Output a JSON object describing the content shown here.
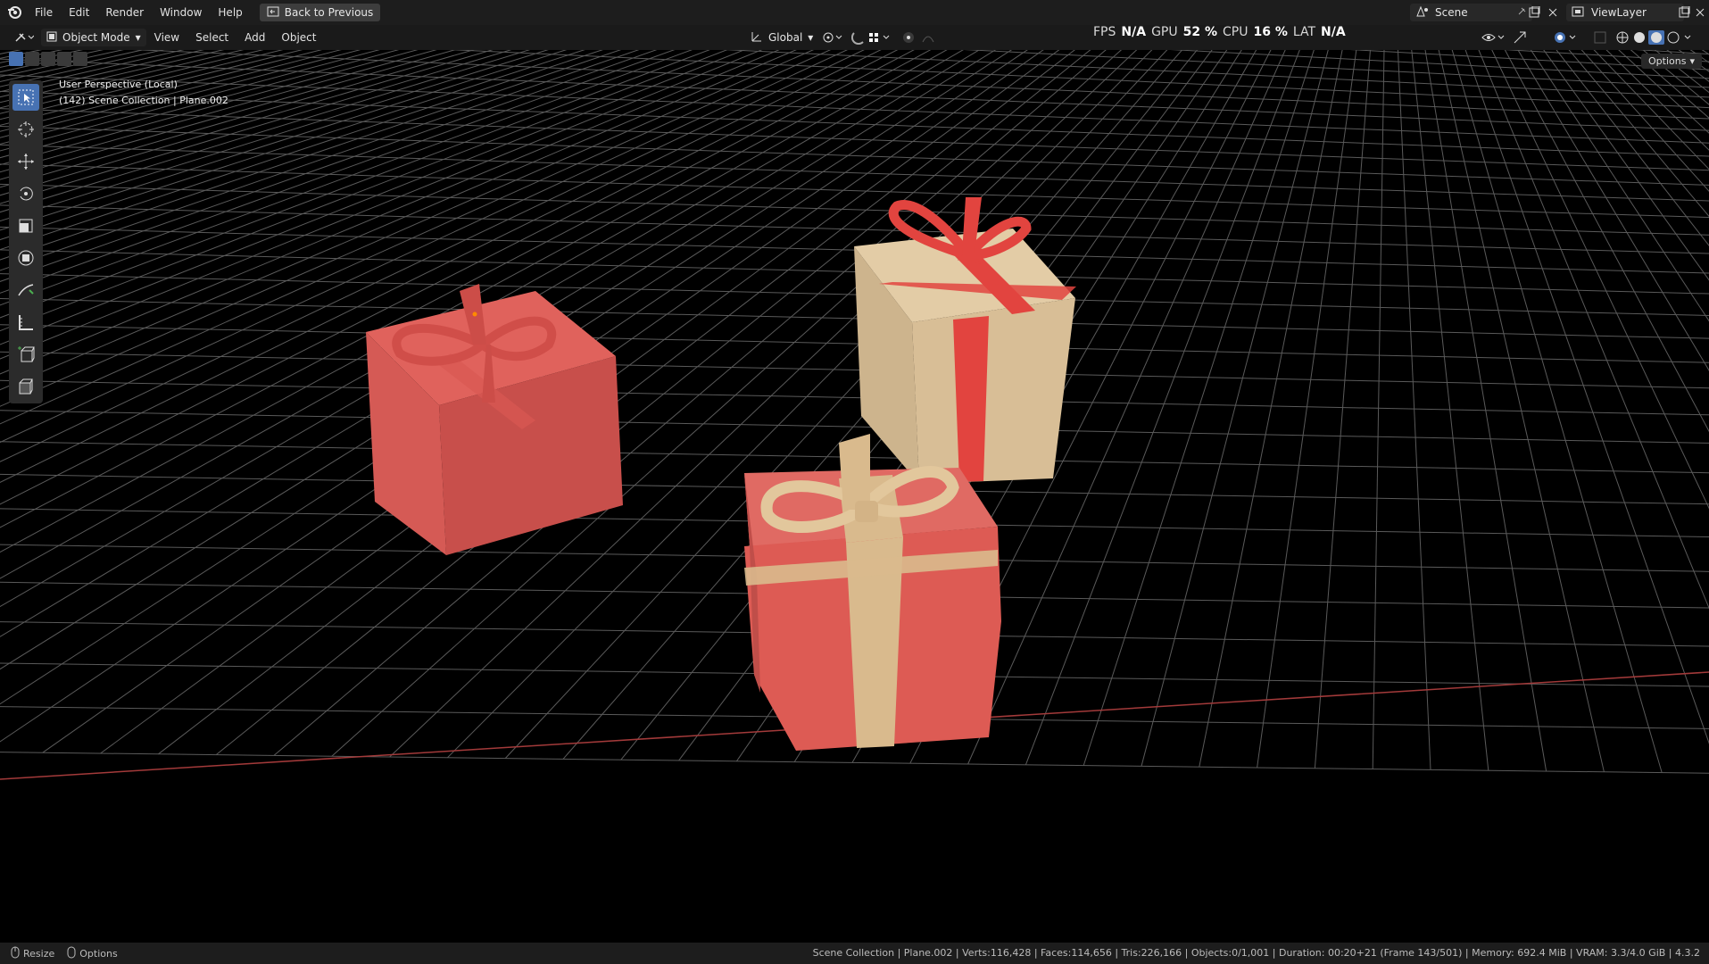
{
  "menu": {
    "items": [
      "File",
      "Edit",
      "Render",
      "Window",
      "Help"
    ],
    "back_label": "Back to Previous"
  },
  "scene": {
    "name": "Scene",
    "view_layer": "ViewLayer"
  },
  "header": {
    "mode": "Object Mode",
    "items": [
      "View",
      "Select",
      "Add",
      "Object"
    ],
    "transform_orientation": "Global",
    "options_label": "Options"
  },
  "performance": {
    "fps_label": "FPS",
    "fps_value": "N/A",
    "gpu_label": "GPU",
    "gpu_value": "52 %",
    "cpu_label": "CPU",
    "cpu_value": "16 %",
    "lat_label": "LAT",
    "lat_value": "N/A"
  },
  "viewport": {
    "view_name": "User Perspective (Local)",
    "collection_info": "(142) Scene Collection | Plane.002"
  },
  "statusbar": {
    "left": [
      "Resize",
      "Options"
    ],
    "info": "Scene Collection | Plane.002 | Verts:116,428 | Faces:114,656 | Tris:226,166 | Objects:0/1,001 | Duration: 00:20+21 (Frame 143/501) | Memory: 692.4 MiB | VRAM: 3.3/4.0 GiB | 4.3.2"
  },
  "colors": {
    "box_red": "#d9534f",
    "box_cream": "#d8b98c",
    "ribbon_red": "#e2443f",
    "x_axis": "#a33a3a",
    "accent": "#4772b3"
  }
}
